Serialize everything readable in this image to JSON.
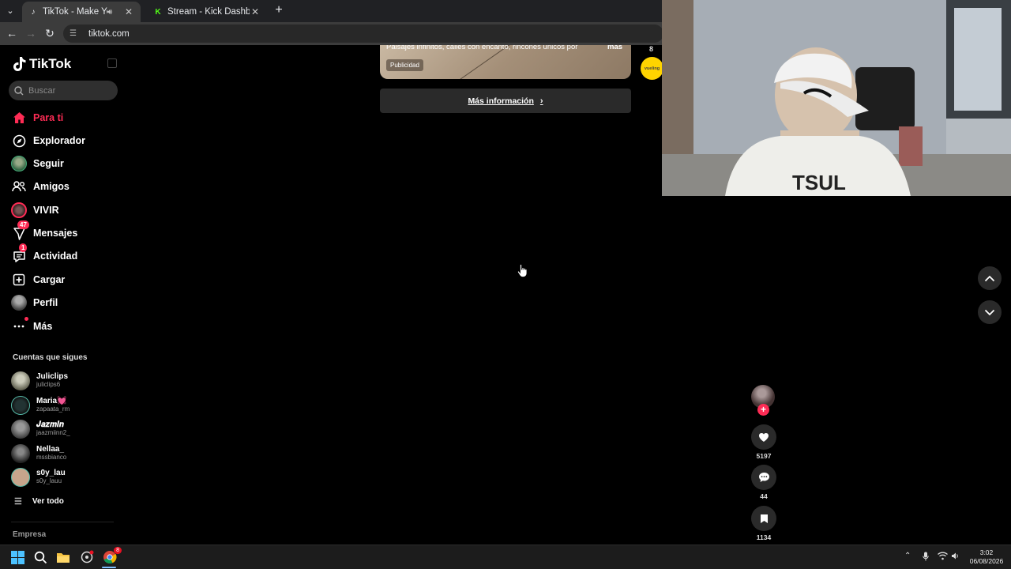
{
  "browser": {
    "tabs": [
      {
        "title": "TikTok - Make Your Day",
        "active": true,
        "audio": true
      },
      {
        "title": "Stream - Kick Dashboard",
        "active": false,
        "audio": false
      }
    ],
    "url": "tiktok.com"
  },
  "sidebar": {
    "logo": "TikTok",
    "search_placeholder": "Buscar",
    "nav": [
      {
        "label": "Para ti",
        "icon": "home-icon",
        "active": true
      },
      {
        "label": "Explorador",
        "icon": "compass-icon"
      },
      {
        "label": "Seguir",
        "icon": "following-avatar-icon"
      },
      {
        "label": "Amigos",
        "icon": "friends-icon"
      },
      {
        "label": "VIVIR",
        "icon": "live-icon"
      },
      {
        "label": "Mensajes",
        "icon": "messages-icon",
        "badge": "47"
      },
      {
        "label": "Actividad",
        "icon": "activity-icon",
        "badge": "1"
      },
      {
        "label": "Cargar",
        "icon": "upload-icon"
      },
      {
        "label": "Perfil",
        "icon": "profile-icon"
      },
      {
        "label": "Más",
        "icon": "more-icon"
      }
    ],
    "following_title": "Cuentas que sigues",
    "following": [
      {
        "name": "Juliclips",
        "handle": "juliclips6"
      },
      {
        "name": "Maria💓",
        "handle": "zapaata_rm"
      },
      {
        "name": "𝑱𝒂𝒛𝒎𝒊𝒏",
        "handle": "jaazmiinn2_"
      },
      {
        "name": "Nellaa_",
        "handle": "mssbianco"
      },
      {
        "name": "s0y_lau",
        "handle": "s0y_lauu"
      }
    ],
    "see_all": "Ver todo",
    "company": "Empresa"
  },
  "ad": {
    "description": "Paisajes infinitos, calles con encanto, rincones únicos por",
    "more": "más",
    "tag": "Publicidad",
    "count": "8",
    "brand": "vueling",
    "cta": "Más información"
  },
  "actions": {
    "likes": "5197",
    "comments": "44",
    "saves": "1134"
  },
  "taskbar": {
    "time": "3:02",
    "date": "06/08/2026",
    "chrome_badge": "8"
  },
  "colors": {
    "accent": "#fe2c55",
    "background": "#000000",
    "surface": "#2a2a2a"
  }
}
